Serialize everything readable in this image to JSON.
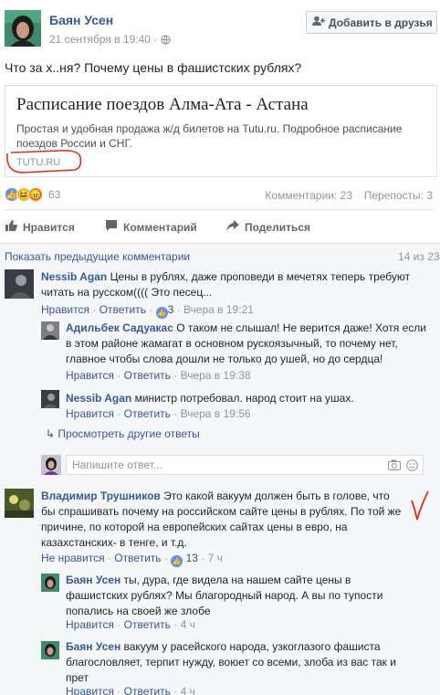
{
  "post": {
    "author": "Баян Усен",
    "timestamp": "21 сентября в 19:40 ·",
    "add_friend_label": "Добавить в друзья",
    "text": "Что за х..ня? Почему цены в фашистских рублях?",
    "link_card": {
      "title": "Расписание поездов Алма-Ата - Астана",
      "description": "Простая и удобная продажа ж/д билетов на Tutu.ru. Подробное расписание поездов России и СНГ.",
      "source": "TUTU.RU"
    },
    "reactions_count": "63",
    "comments_count": "Комментарии: 23",
    "shares_count": "Перепосты: 3",
    "actions": {
      "like": "Нравится",
      "comment": "Комментарий",
      "share": "Поделиться"
    }
  },
  "comments_section": {
    "show_previous": "Показать предыдущие комментарии",
    "counter": "14 из 23",
    "reply_placeholder": "Напишите ответ...",
    "more_replies": "Просмотреть другие ответы",
    "c1": {
      "author": "Nessib Agan",
      "text": " Цены в рублях, даже проповеди в мечетях теперь требуют читать на русском(((( Это песец...",
      "like": "Нравится",
      "reply": "Ответить",
      "likes": "3",
      "time": "Вчера в 19:21"
    },
    "r1": {
      "author": "Адильбек Садуакас",
      "text": " О таком не слышал! Не верится даже! Хотя если в этом районе жамагат в основном рускоязычный, то почему нет, главное чтобы слова дошли не только до ушей, но до сердца!",
      "like": "Нравится",
      "reply": "Ответить",
      "time": "Вчера в 19:38"
    },
    "r2": {
      "author": "Nessib Agan",
      "text": " министр потребовал. народ стоит на ушах.",
      "like": "Нравится",
      "reply": "Ответить",
      "time": "Вчера в 19:56"
    },
    "c2": {
      "author": "Владимир Трушников",
      "text": " Это какой вакуум должен быть в голове, что бы спрашивать почему на российском сайте цены в рублях. По той же причине, по которой на европейских сайтах цены в евро, на казахстанских- в тенге, и т.д.",
      "like": "Не нравится",
      "reply": "Ответить",
      "likes": "13",
      "time": "7 ч"
    },
    "r3": {
      "author": "Баян Усен",
      "text": " ты, дура, где видела на нашем сайте цены в фашистских рублях? Мы благородный народ. А вы по тупости попались на своей же злобе",
      "like": "Нравится",
      "reply": "Ответить",
      "time": "4 ч"
    },
    "r4": {
      "author": "Баян Усен",
      "text": " вакуум у расейского народа, узкоглазого фашиста благословляет, терпит нужду, воюет со всеми, злоба из вас так и прет",
      "like": "Нравится",
      "reply": "Ответить",
      "time": "4 ч"
    }
  },
  "colors": {
    "link": "#365899",
    "muted": "#90949c",
    "annotation_red": "#e8291c",
    "bg_comments": "#f6f7f9"
  },
  "icons": [
    "globe-icon",
    "add-friend-icon",
    "like-icon",
    "comment-icon",
    "share-icon",
    "camera-icon",
    "emoji-icon",
    "reply-arrow-icon"
  ]
}
